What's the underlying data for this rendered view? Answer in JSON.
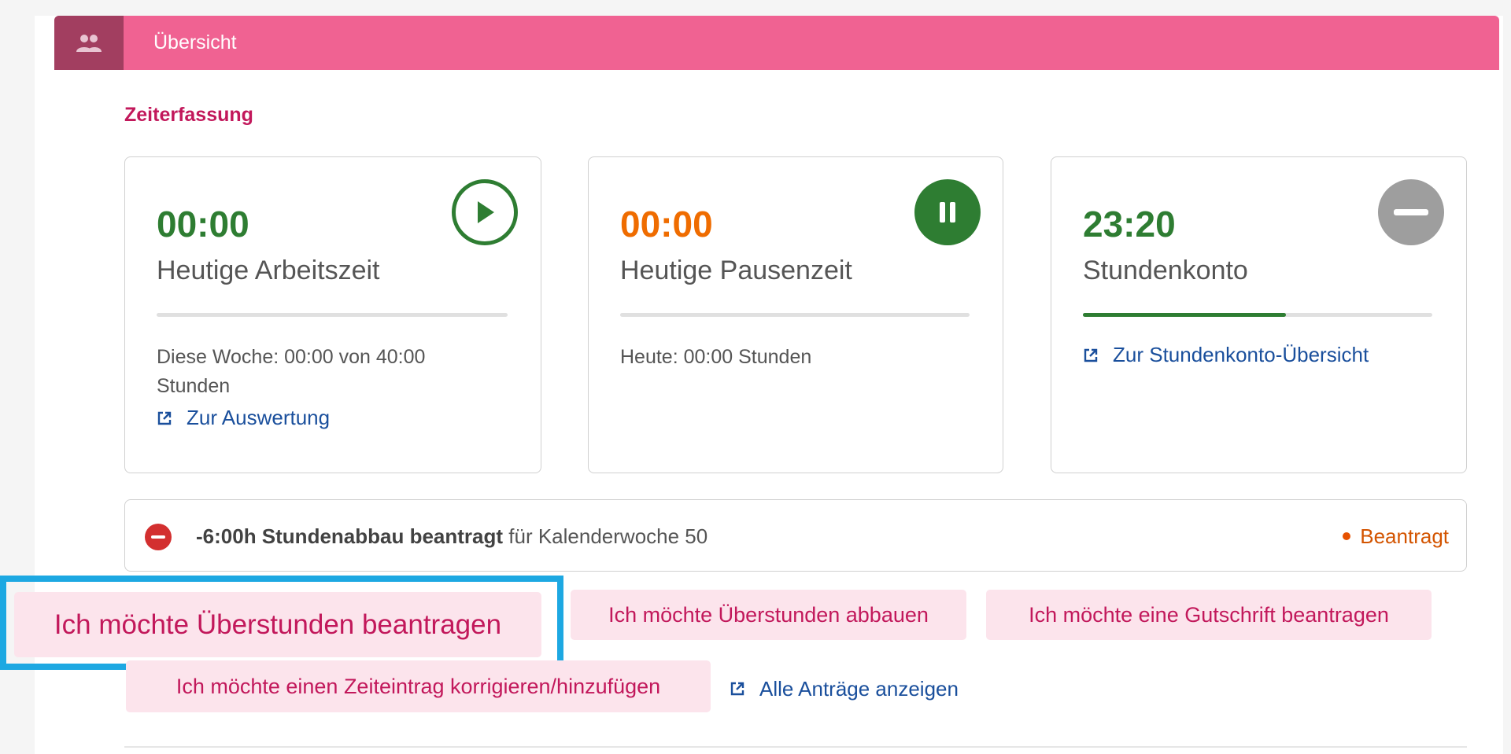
{
  "header": {
    "title": "Übersicht",
    "icon": "people-icon"
  },
  "section": {
    "title": "Zeiterfassung"
  },
  "cards": {
    "work": {
      "time": "00:00",
      "label": "Heutige Arbeitszeit",
      "info": "Diese Woche: 00:00 von 40:00 Stunden",
      "link": "Zur Auswertung",
      "action_icon": "play-icon",
      "color": "#2e7d32"
    },
    "pause": {
      "time": "00:00",
      "label": "Heutige Pausenzeit",
      "info": "Heute: 00:00 Stunden",
      "action_icon": "pause-icon",
      "color": "#ef6c00"
    },
    "account": {
      "time": "23:20",
      "label": "Stundenkonto",
      "link": "Zur Stundenkonto-Übersicht",
      "action_icon": "minus-icon",
      "progress": 0.58,
      "color": "#2e7d32"
    }
  },
  "request": {
    "bold": "-6:00h Stundenabbau beantragt",
    "rest": " für Kalenderwoche 50",
    "status": "Beantragt"
  },
  "buttons": {
    "overtime_request": "Ich möchte Überstunden beantragen",
    "overtime_reduce": "Ich möchte Überstunden abbauen",
    "credit": "Ich möchte eine Gutschrift beantragen",
    "correct": "Ich möchte einen Zeiteintrag korrigieren/hinzufügen"
  },
  "links": {
    "all_requests": "Alle Anträge anzeigen"
  },
  "colors": {
    "header": "#f06292",
    "header_icon_bg": "#a23e60",
    "accent": "#c2185b",
    "link": "#1a4f9c",
    "status": "#d35400",
    "focus": "#1da8e2"
  }
}
